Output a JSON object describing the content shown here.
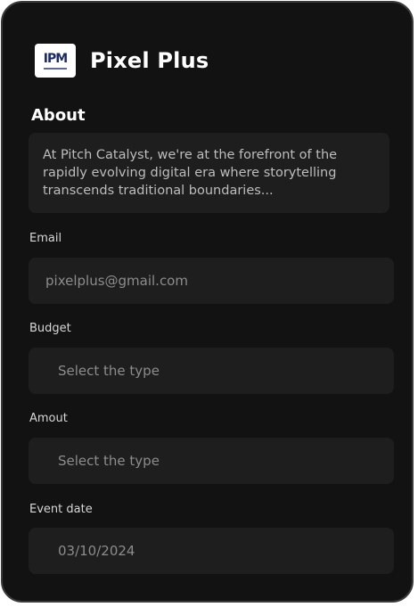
{
  "brand": {
    "logo_text": "IPM",
    "name": "Pixel Plus"
  },
  "about": {
    "title": "About",
    "text": "At Pitch Catalyst, we're at the forefront of the rapidly evolving digital era where storytelling transcends traditional boundaries..."
  },
  "form": {
    "email": {
      "label": "Email",
      "value": "pixelplus@gmail.com"
    },
    "budget": {
      "label": "Budget",
      "placeholder": "Select the type"
    },
    "amount": {
      "label": "Amout",
      "placeholder": "Select the type"
    },
    "event_date": {
      "label": "Event date",
      "value": "03/10/2024"
    }
  },
  "colors": {
    "background": "#121212",
    "field_background": "#1e1e1e",
    "logo_accent": "#1b2a63"
  }
}
